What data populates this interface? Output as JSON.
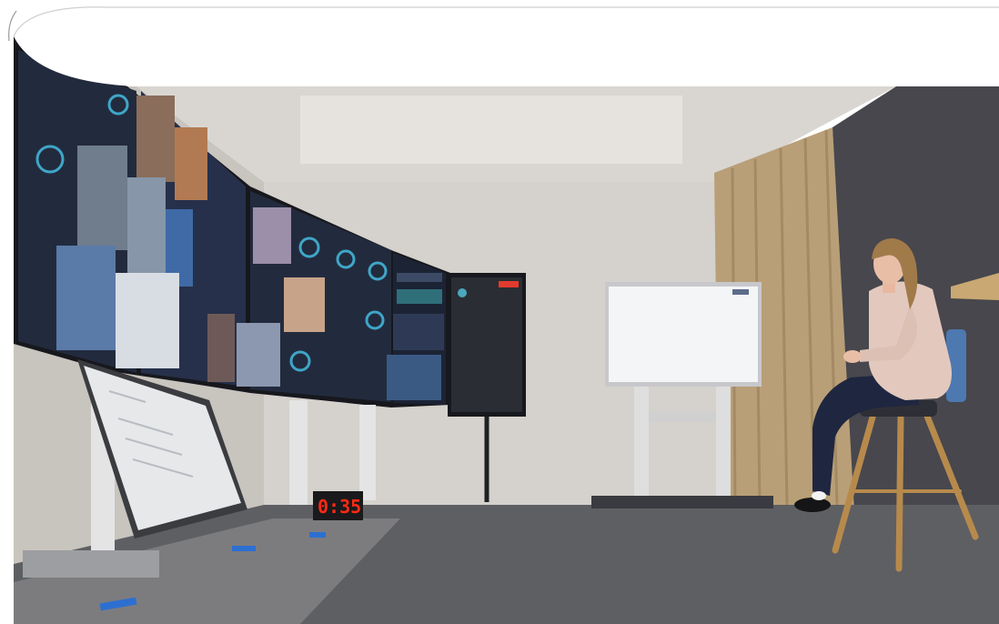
{
  "photo": {
    "clock_display": "0:35",
    "colors": {
      "frame_white": "#ffffff",
      "frame_line": "#cfcfcf",
      "ceiling": "#d9d6d2",
      "left_wall": "#c8c4be",
      "back_wall": "#d5d1cc",
      "curtain": "#b99f77",
      "dark_panel": "#47474d",
      "floor": "#5e5f63",
      "screen_bezel": "#17181d",
      "video_bg": "#222b3d",
      "whiteboard": "#f4f5f6",
      "stand": "#dedede",
      "presenter_jacket": "#e3c9bd",
      "presenter_pants": "#1f2640",
      "presenter_hair": "#a17a4a",
      "stool_wood": "#b78a4c",
      "clock_red": "#ff2a14",
      "tape_blue": "#2d6fd1"
    }
  }
}
